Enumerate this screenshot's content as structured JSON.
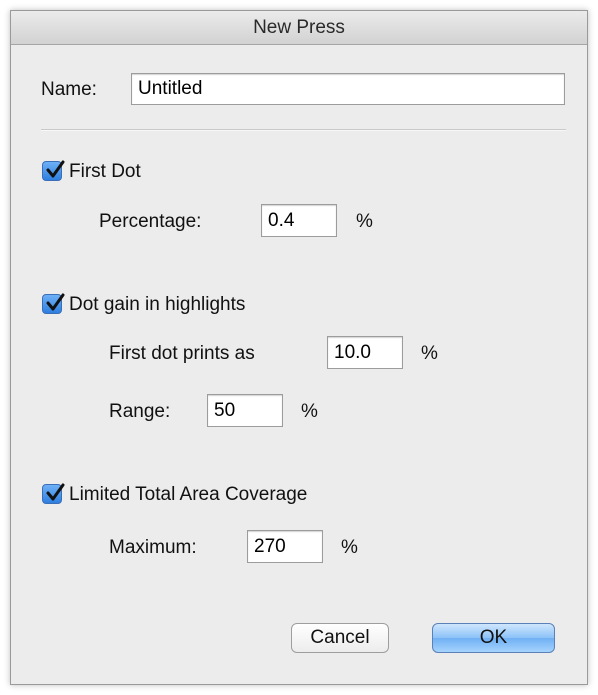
{
  "window": {
    "title": "New Press"
  },
  "name_field": {
    "label": "Name:",
    "value": "Untitled"
  },
  "first_dot": {
    "checkbox_label": "First Dot",
    "checked": true,
    "percentage_label": "Percentage:",
    "percentage_value": "0.4",
    "percentage_unit": "%"
  },
  "dot_gain": {
    "checkbox_label": "Dot gain in highlights",
    "checked": true,
    "first_dot_prints_label": "First dot prints as",
    "first_dot_prints_value": "10.0",
    "first_dot_prints_unit": "%",
    "range_label": "Range:",
    "range_value": "50",
    "range_unit": "%"
  },
  "tac": {
    "checkbox_label": "Limited Total Area Coverage",
    "checked": true,
    "maximum_label": "Maximum:",
    "maximum_value": "270",
    "maximum_unit": "%"
  },
  "buttons": {
    "cancel": "Cancel",
    "ok": "OK"
  },
  "colors": {
    "checkbox_accent": "#3d8be8",
    "default_button": "#8cc2f8",
    "dialog_background": "#ececec"
  }
}
